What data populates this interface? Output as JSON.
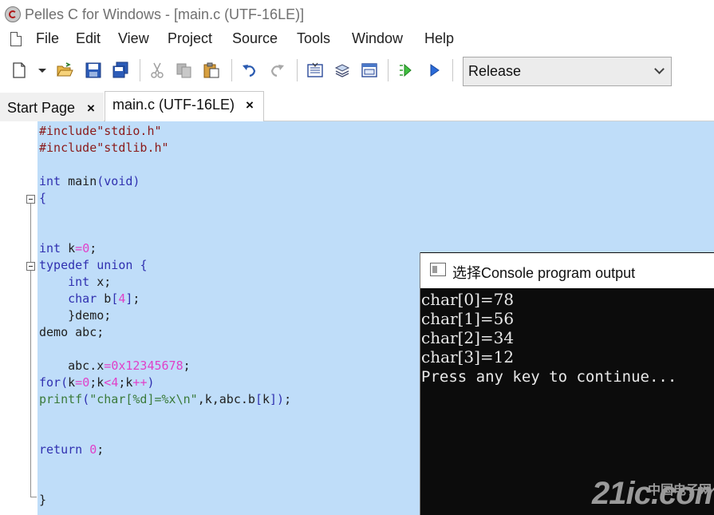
{
  "window": {
    "title": "Pelles C for Windows - [main.c (UTF-16LE)]"
  },
  "menu": [
    "File",
    "Edit",
    "View",
    "Project",
    "Source",
    "Tools",
    "Window",
    "Help"
  ],
  "toolbar": {
    "build_config": "Release",
    "icons": [
      "new-file-icon",
      "dropdown-arrow-icon",
      "open-folder-icon",
      "save-icon",
      "save-all-icon",
      "cut-icon",
      "copy-icon",
      "paste-icon",
      "undo-icon",
      "redo-icon",
      "compile-icon",
      "build-icon",
      "project-icon",
      "debug-icon",
      "execute-icon"
    ]
  },
  "tabs": [
    {
      "label": "Start Page",
      "close": "×"
    },
    {
      "label": "main.c (UTF-16LE)",
      "close": "×"
    }
  ],
  "code": [
    "#include\"stdio.h\"",
    "#include\"stdlib.h\"",
    "",
    "int main(void)",
    "{",
    "",
    "",
    "int k=0;",
    "typedef union {",
    "    int x;",
    "    char b[4];",
    "    }demo;",
    "demo abc;",
    "",
    "    abc.x=0x12345678;",
    "for(k=0;k<4;k++)",
    "printf(\"char[%d]=%x\\n\",k,abc.b[k]);",
    "",
    "",
    "return 0;",
    "",
    "",
    "}"
  ],
  "console": {
    "title": "选择Console program output",
    "lines": [
      "char[0]=78",
      "char[1]=56",
      "char[2]=34",
      "char[3]=12",
      "Press any key to continue..."
    ]
  },
  "watermark": {
    "brand": "21ic.com",
    "cn": "中国电子网"
  },
  "colors": {
    "selection": "#bfddf9",
    "console_bg": "#0c0c0c",
    "preprocessor": "#8b1a1a",
    "keyword": "#3030b0",
    "number": "#e040c8",
    "string": "#3a7a3a"
  }
}
